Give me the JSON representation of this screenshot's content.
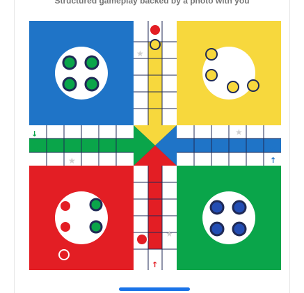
{
  "caption": "Structured gameplay backed by a photo with you",
  "board": {
    "colors": {
      "red": "#e31e24",
      "green": "#0aa54a",
      "yellow": "#f7d83d",
      "blue": "#1f74c7",
      "frame": "#1f2a56",
      "pawn_green": "#0aa54a",
      "pawn_blue": "#234db3"
    },
    "arrows": {
      "left": "➤",
      "right": "←",
      "up": "↑",
      "top_down": "↓"
    }
  }
}
